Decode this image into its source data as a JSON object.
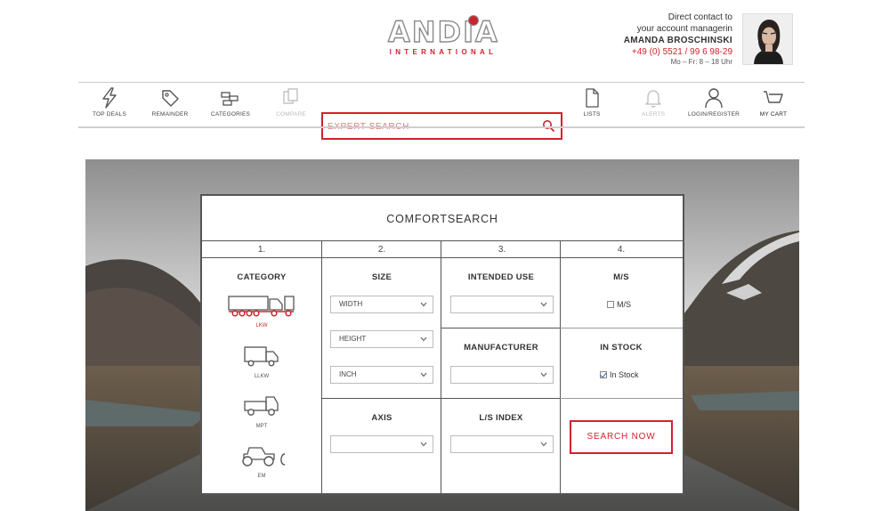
{
  "brand": {
    "name": "ANDIA",
    "subtitle": "INTERNATIONAL",
    "accent": "#d0232a"
  },
  "contact": {
    "line1": "Direct contact to",
    "line2": "your account managerin",
    "name": "AMANDA BROSCHINSKI",
    "phone": "+49 (0) 5521 / 99 6 98-29",
    "hours": "Mo – Fr: 8 – 18 Uhr"
  },
  "nav": {
    "left": [
      {
        "label": "TOP DEALS",
        "icon": "lightning-icon"
      },
      {
        "label": "REMAINDER",
        "icon": "tag-icon"
      },
      {
        "label": "CATEGORIES",
        "icon": "categories-icon"
      },
      {
        "label": "COMPARE",
        "icon": "compare-icon"
      }
    ],
    "right": [
      {
        "label": "LISTS",
        "icon": "document-icon"
      },
      {
        "label": "ALERTS",
        "icon": "bell-icon"
      },
      {
        "label": "LOGIN/REGISTER",
        "icon": "user-icon"
      },
      {
        "label": "MY CART",
        "icon": "cart-icon"
      }
    ],
    "search_placeholder": "EXPERT SEARCH"
  },
  "form": {
    "title": "COMFORTSEARCH",
    "steps": [
      "1.",
      "2.",
      "3.",
      "4."
    ],
    "category": {
      "heading": "CATEGORY",
      "items": [
        {
          "label": "LKW",
          "active": true
        },
        {
          "label": "LLKW",
          "active": false
        },
        {
          "label": "MPT",
          "active": false
        },
        {
          "label": "EM",
          "active": false
        }
      ]
    },
    "size": {
      "heading": "SIZE",
      "width": "WIDTH",
      "height": "HEIGHT",
      "inch": "INCH"
    },
    "axis": {
      "heading": "AXIS",
      "value": ""
    },
    "intended_use": {
      "heading": "INTENDED USE",
      "value": ""
    },
    "manufacturer": {
      "heading": "MANUFACTURER",
      "value": ""
    },
    "ls_index": {
      "heading": "L/S INDEX",
      "value": ""
    },
    "ms": {
      "heading": "M/S",
      "checkbox_label": "M/S",
      "checked": false
    },
    "in_stock": {
      "heading": "IN STOCK",
      "checkbox_label": "In Stock",
      "checked": true
    },
    "submit": "SEARCH NOW"
  }
}
